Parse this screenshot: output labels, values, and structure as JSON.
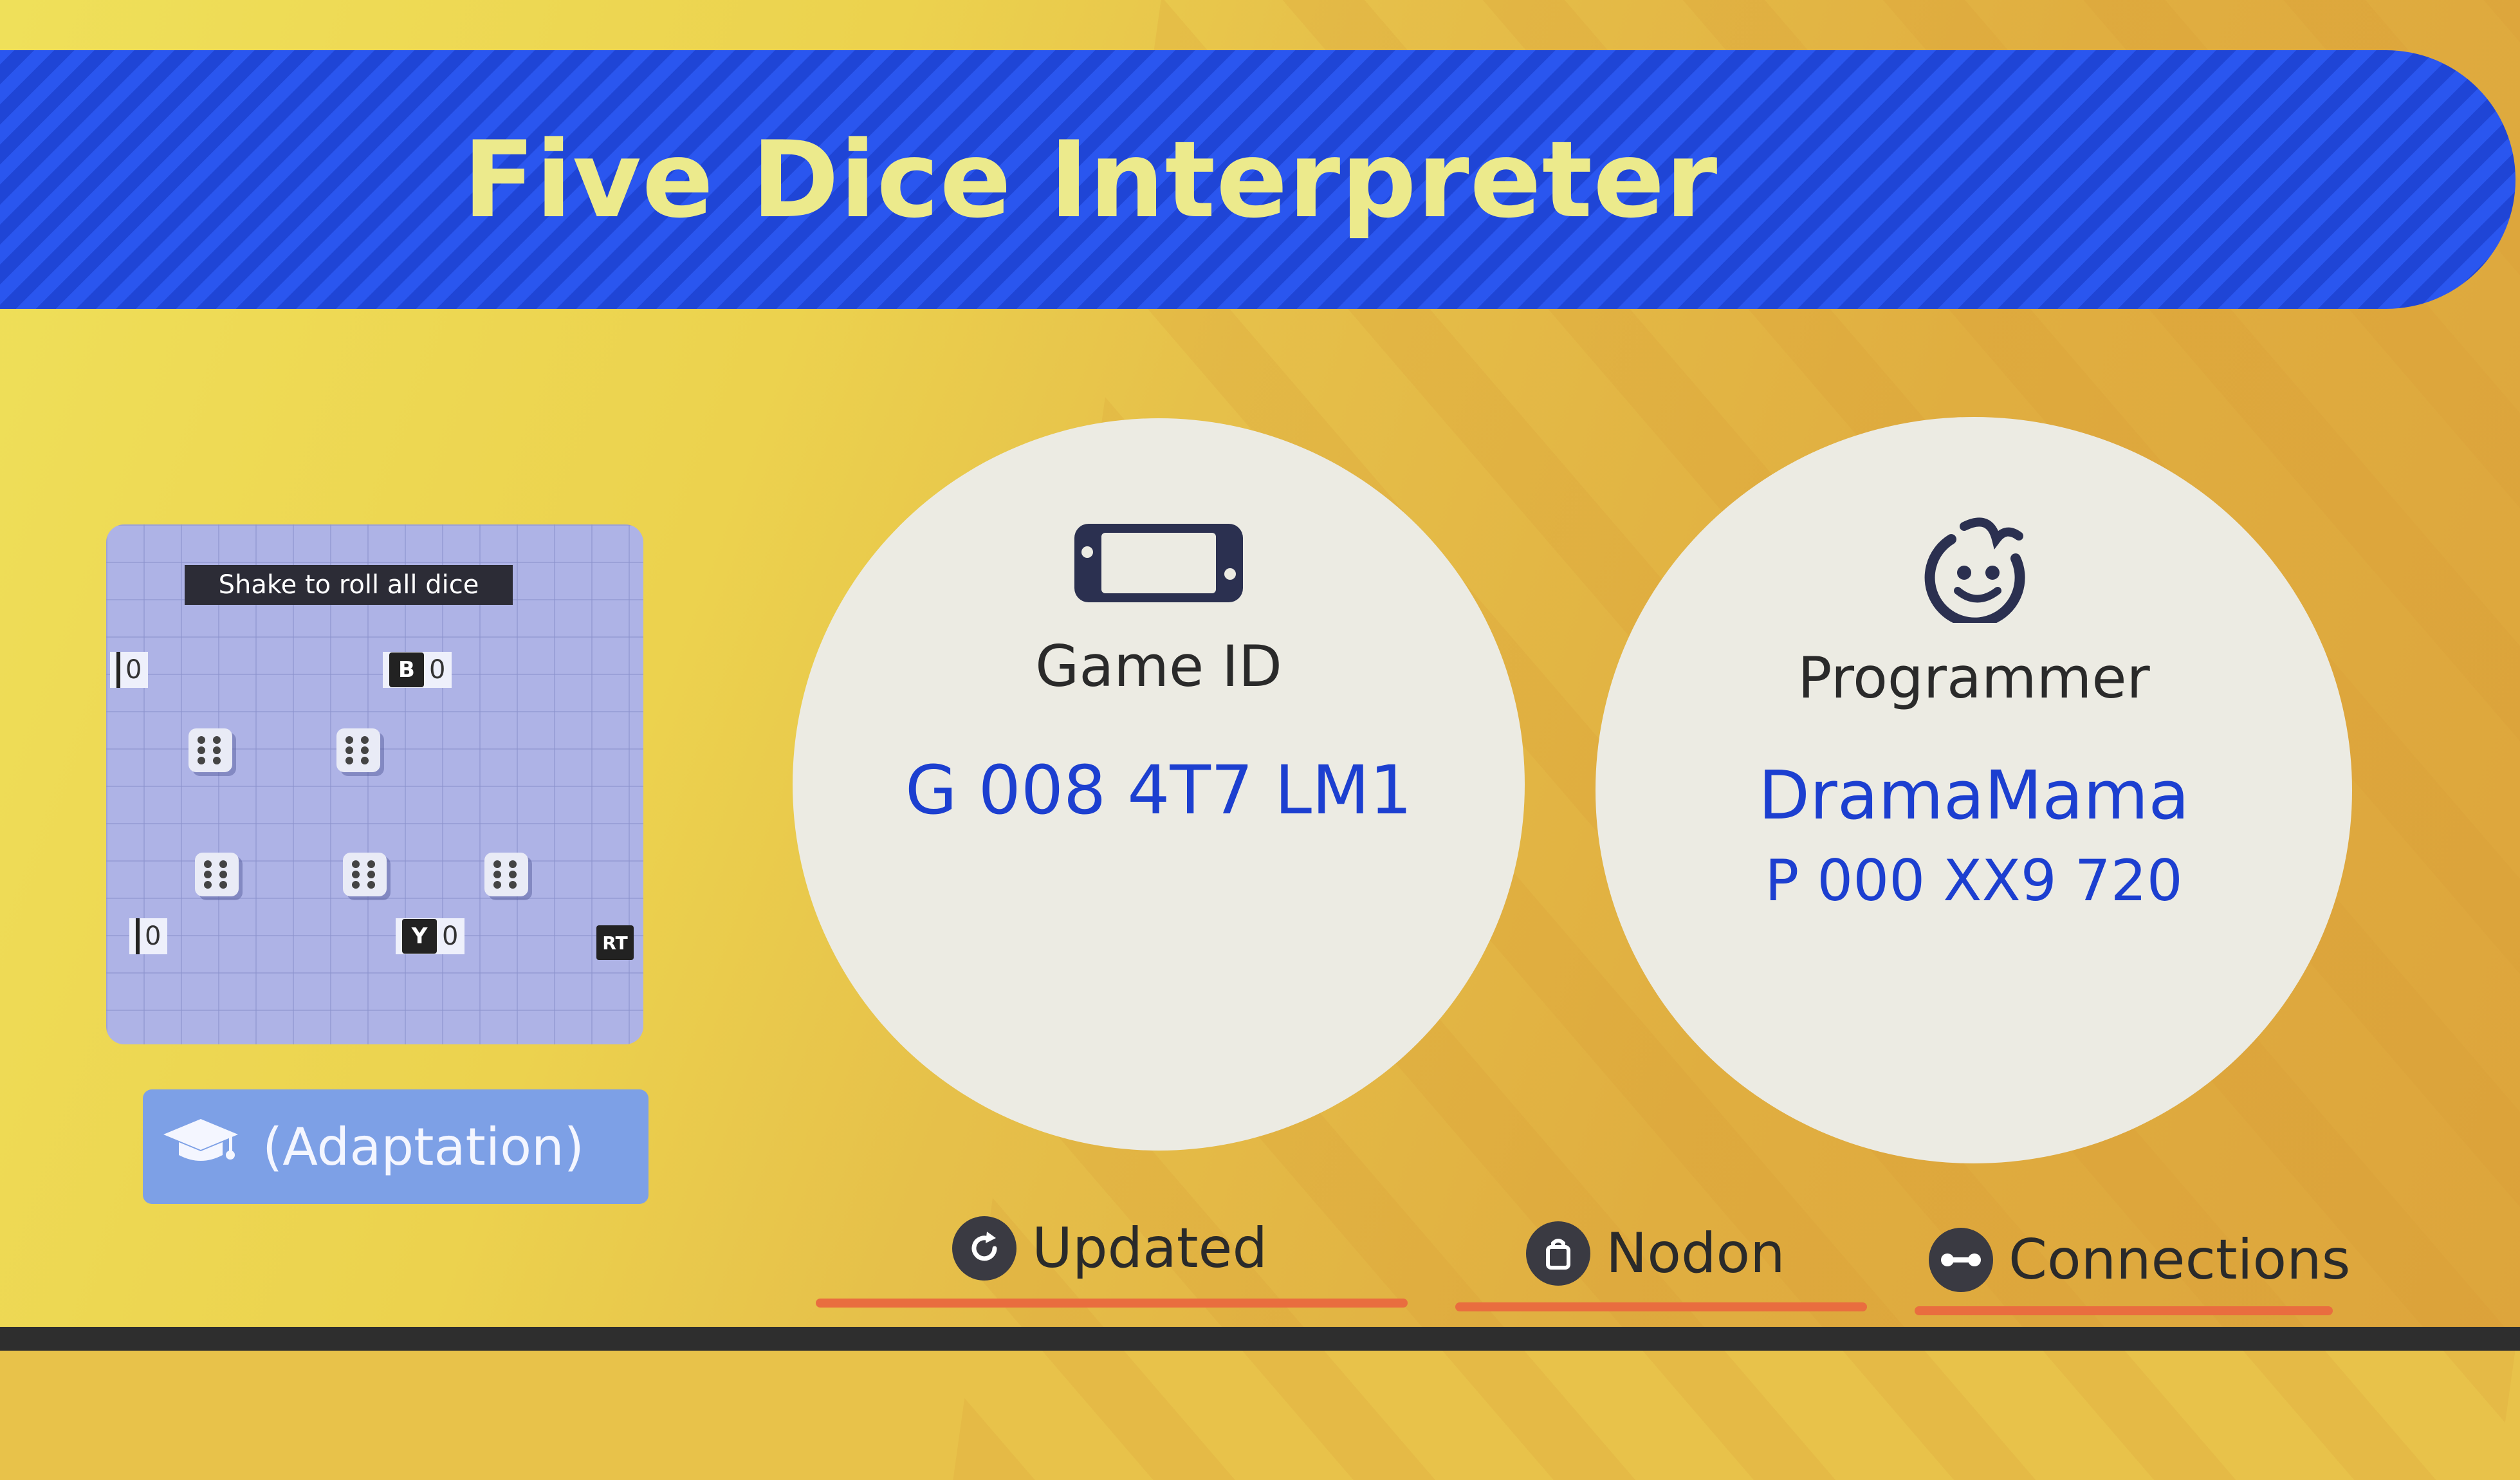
{
  "title": "Five Dice Interpreter",
  "preview": {
    "banner": "Shake to roll all dice",
    "counters": [
      {
        "key": "",
        "value": "0"
      },
      {
        "key": "B",
        "value": "0"
      },
      {
        "key": "",
        "value": "0"
      },
      {
        "key": "Y",
        "value": "0"
      }
    ],
    "rt_label": "RT"
  },
  "adaptation_label": "(Adaptation)",
  "game_id": {
    "label": "Game ID",
    "value": "G 008 4T7 LM1"
  },
  "programmer": {
    "label": "Programmer",
    "name": "DramaMama",
    "id": "P 000 XX9 720"
  },
  "footer": {
    "updated": "Updated",
    "nodon": "Nodon",
    "connections": "Connections"
  },
  "colors": {
    "title_bar": "#2a56ef",
    "title_text": "#ecea8c",
    "value_text": "#1c3fd0",
    "underline": "#e96d3f"
  },
  "icons": {
    "game_id": "switch-console-icon",
    "programmer": "smiley-face-icon",
    "adaptation": "graduation-cap-icon",
    "updated": "refresh-icon",
    "nodon": "bag-icon",
    "connections": "link-icon"
  }
}
